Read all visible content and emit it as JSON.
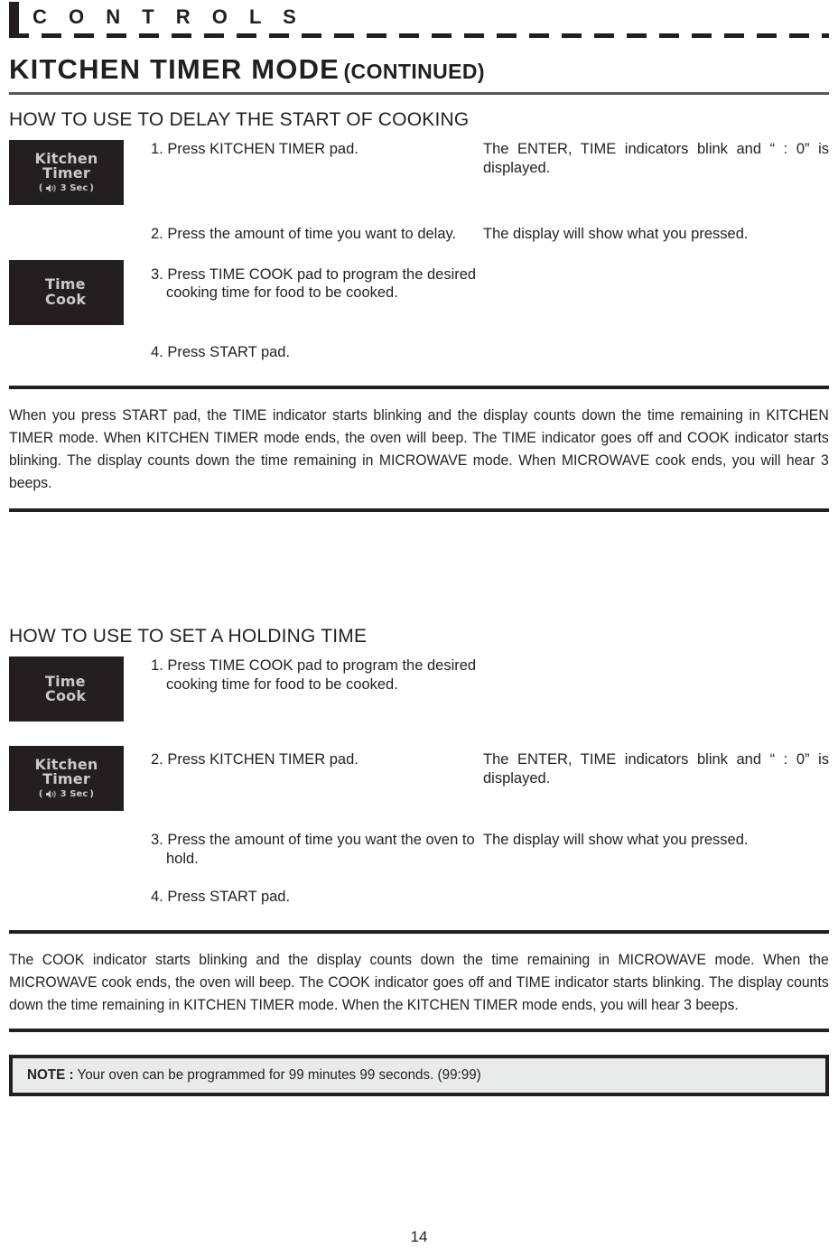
{
  "running_head": {
    "label": "C O N T R O L S"
  },
  "chapter": {
    "title": "KITCHEN TIMER MODE",
    "continued": "(CONTINUED)"
  },
  "sections": [
    {
      "heading": "HOW TO USE TO DELAY THE START OF COOKING",
      "pads": [
        {
          "lines": [
            "Kitchen",
            "Timer"
          ],
          "sub": "3 Sec",
          "sub_open": "(",
          "sub_close": ")",
          "icon": "speaker-icon"
        },
        {
          "lines": [
            "Time",
            "Cook"
          ],
          "sub": "",
          "icon": ""
        }
      ],
      "steps": [
        "1. Press KITCHEN TIMER pad.",
        "2. Press the amount of time you want to delay.",
        "3. Press TIME COOK pad to program the desired cooking time for food to be cooked.",
        "4. Press START pad."
      ],
      "responses": [
        "The ENTER, TIME indicators blink and “ : 0” is displayed.",
        "The display will show what you pressed.",
        "",
        ""
      ],
      "summary": "When you press START pad, the TIME indicator starts blinking and the display counts down the time remaining in KITCHEN TIMER mode. When KITCHEN TIMER mode ends, the oven will beep. The TIME indicator goes off and COOK indicator starts blinking. The display counts down the time remaining in MICROWAVE mode. When MICROWAVE cook ends, you will hear 3 beeps."
    },
    {
      "heading": "HOW TO USE TO SET A HOLDING TIME",
      "pads": [
        {
          "lines": [
            "Time",
            "Cook"
          ],
          "sub": "",
          "icon": ""
        },
        {
          "lines": [
            "Kitchen",
            "Timer"
          ],
          "sub": "3 Sec",
          "sub_open": "(",
          "sub_close": ")",
          "icon": "speaker-icon"
        }
      ],
      "steps": [
        "1. Press TIME COOK pad to program the desired cooking time for food to be cooked.",
        "2. Press KITCHEN TIMER pad.",
        "3. Press the amount of time you want the oven to hold.",
        "4. Press START pad."
      ],
      "responses": [
        "",
        "The ENTER, TIME indicators blink and “ : 0” is displayed.",
        "The display will show what you pressed.",
        ""
      ],
      "summary": "The COOK indicator starts blinking and the display counts down the time remaining in MICROWAVE mode. When the MICROWAVE cook ends, the oven will beep. The COOK indicator goes off and TIME indicator starts blinking. The display counts down the time remaining in KITCHEN TIMER mode. When the KITCHEN TIMER mode ends, you will hear 3 beeps."
    }
  ],
  "note": {
    "label": "NOTE :",
    "text": " Your oven can be programmed for 99 minutes 99 seconds. (99:99)"
  },
  "footer": {
    "page_number": "14"
  },
  "colors": {
    "ink": "#231f20",
    "pad_bg": "#231f20",
    "pad_text": "#c9c9c9",
    "rule_gray": "#58595b",
    "note_bg": "#e9eaea"
  }
}
